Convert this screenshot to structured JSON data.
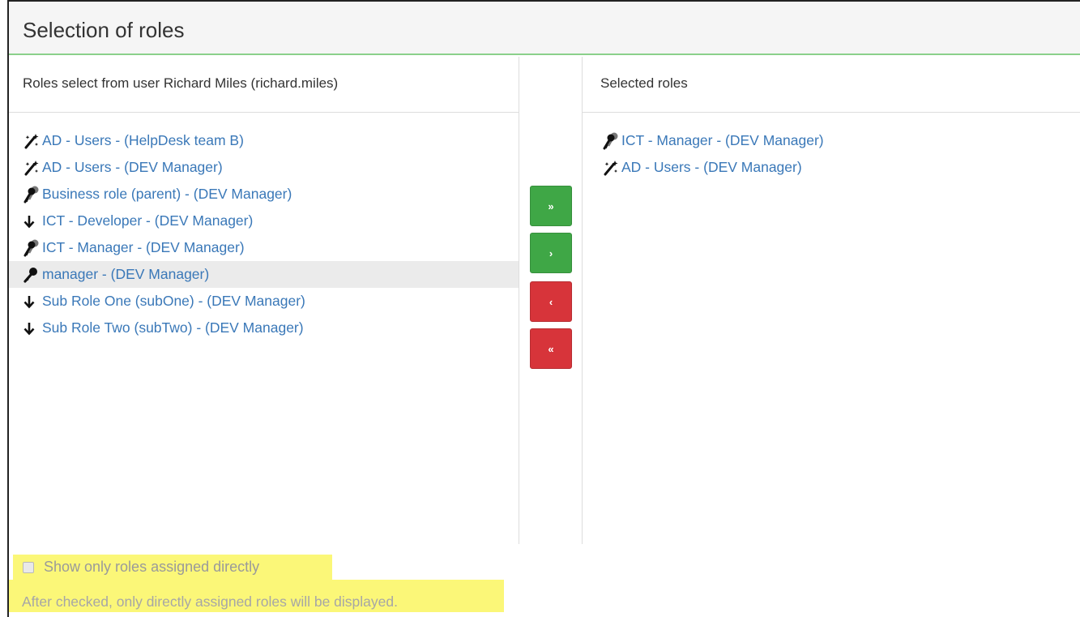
{
  "panel": {
    "title": "Selection of roles"
  },
  "available": {
    "header": "Roles select from user Richard Miles (richard.miles)",
    "items": [
      {
        "icon": "magic-wand-icon",
        "label": "AD - Users - (HelpDesk team B)"
      },
      {
        "icon": "magic-wand-icon",
        "label": "AD - Users - (DEV Manager)"
      },
      {
        "icon": "keys-icon",
        "label": "Business role (parent) - (DEV Manager)"
      },
      {
        "icon": "arrow-down-icon",
        "label": "ICT - Developer - (DEV Manager)"
      },
      {
        "icon": "keys-icon",
        "label": "ICT - Manager - (DEV Manager)"
      },
      {
        "icon": "key-icon",
        "label": "manager - (DEV Manager)"
      },
      {
        "icon": "arrow-down-icon",
        "label": "Sub Role One (subOne) - (DEV Manager)"
      },
      {
        "icon": "arrow-down-icon",
        "label": "Sub Role Two (subTwo) - (DEV Manager)"
      }
    ]
  },
  "buttons": {
    "add_all": "»",
    "add": "›",
    "remove": "‹",
    "remove_all": "«"
  },
  "selected": {
    "header": "Selected roles",
    "items": [
      {
        "icon": "keys-icon",
        "label": "ICT - Manager - (DEV Manager)"
      },
      {
        "icon": "magic-wand-icon",
        "label": "AD - Users - (DEV Manager)"
      }
    ]
  },
  "footer": {
    "checkbox_label": "Show only roles assigned directly",
    "checked": false,
    "help_text": "After checked, only directly assigned roles will be displayed."
  },
  "colors": {
    "link": "#3a78b8",
    "green_button": "#3fa746",
    "red_button": "#d7343a",
    "highlight": "#fbf778",
    "heading_border": "#8bd08b"
  }
}
